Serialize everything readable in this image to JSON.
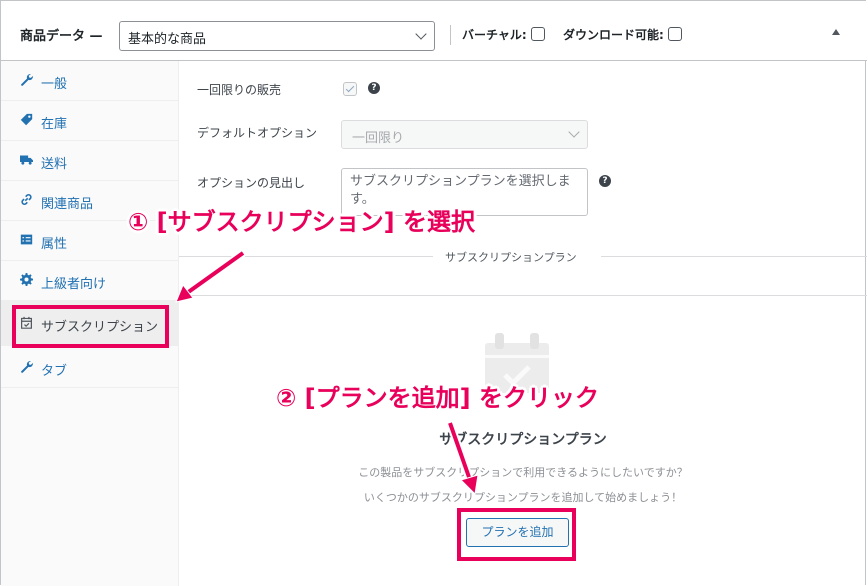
{
  "header": {
    "title": "商品データ —",
    "product_type": "基本的な商品",
    "virtual_label": "バーチャル:",
    "downloadable_label": "ダウンロード可能:"
  },
  "sidebar": {
    "items": [
      {
        "label": "一般",
        "icon": "wrench-icon"
      },
      {
        "label": "在庫",
        "icon": "tag-icon"
      },
      {
        "label": "送料",
        "icon": "truck-icon"
      },
      {
        "label": "関連商品",
        "icon": "link-icon"
      },
      {
        "label": "属性",
        "icon": "list-icon"
      },
      {
        "label": "上級者向け",
        "icon": "gear-icon"
      },
      {
        "label": "サブスクリプション",
        "icon": "calendar-check-icon",
        "active": true
      },
      {
        "label": "タブ",
        "icon": "wrench-icon"
      }
    ]
  },
  "main": {
    "one_time_label": "一回限りの販売",
    "one_time_checked": true,
    "default_option_label": "デフォルトオプション",
    "default_option_value": "一回限り",
    "option_heading_label": "オプションの見出し",
    "option_heading_value": "サブスクリプションプランを選択します。",
    "section_title": "サブスクリプションプラン",
    "empty_title": "サブスクリプションプラン",
    "empty_line1": "この製品をサブスクリプションで利用できるようにしたいですか？",
    "empty_line2": "いくつかのサブスクリプションプランを追加して始めましょう！",
    "add_button": "プランを追加"
  },
  "annotations": {
    "step1": "① [サブスクリプション] を選択",
    "step2": "② [プランを追加] をクリック"
  },
  "colors": {
    "accent": "#e8005a",
    "link": "#2271b1"
  }
}
